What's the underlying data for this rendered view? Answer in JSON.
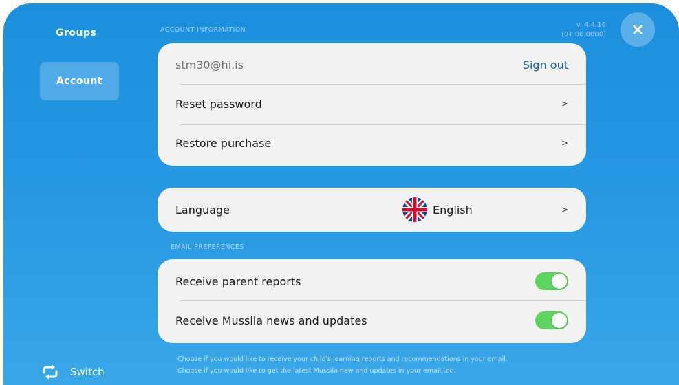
{
  "sidebar": {
    "groups_label": "Groups",
    "account_label": "Account",
    "switch_label": "Switch"
  },
  "header": {
    "section_account": "ACCOUNT INFORMATION",
    "version": "v. 4.4.16",
    "build": "(01.00.0000)"
  },
  "account": {
    "email": "stm30@hi.is",
    "sign_out": "Sign out",
    "reset_password": "Reset password",
    "restore_purchase": "Restore purchase",
    "chevron": ">"
  },
  "language": {
    "label": "Language",
    "value": "English",
    "flag": "uk-flag-icon"
  },
  "email_prefs": {
    "section_label": "EMAIL PREFERENCES",
    "parent_reports": "Receive parent reports",
    "parent_reports_on": true,
    "news": "Receive Mussila news and updates",
    "news_on": true
  },
  "footnote": {
    "line1": "Choose if you would like to receive your child's learning reports and recommendations in your email.",
    "line2": "Choose if you would like to get the latest Mussila new and updates in your email too."
  },
  "colors": {
    "background": "#1b8fde",
    "link": "#1a5fb4",
    "toggle_on": "#5fd35f",
    "card": "#f2f2f2"
  }
}
